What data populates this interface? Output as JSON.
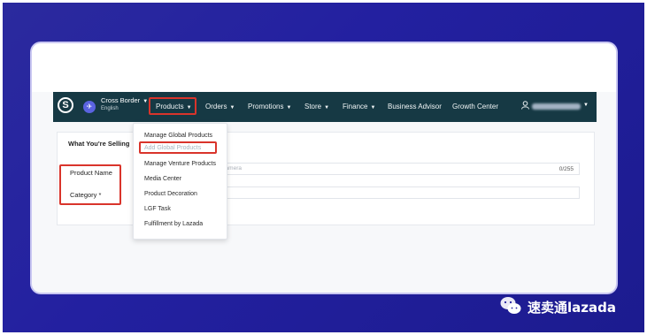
{
  "navbar": {
    "cross_border": "Cross Border",
    "language": "English",
    "items": [
      "Products",
      "Orders",
      "Promotions",
      "Store",
      "Finance",
      "Business Advisor",
      "Growth Center"
    ]
  },
  "products_menu": {
    "items": [
      "Manage Global Products",
      "Add Global Products",
      "Manage Venture Products",
      "Media Center",
      "Product Decoration",
      "LGF Task",
      "Fulfillment by Lazada"
    ],
    "highlighted": "Add Global Products"
  },
  "form": {
    "section_title": "What You're Selling",
    "product_name_label": "Product Name",
    "category_label": "Category *",
    "product_name_placeholder": "al Camera",
    "char_counter": "0/255"
  },
  "watermark": {
    "text": "速卖通lazada"
  },
  "colors": {
    "navbar": "#163944",
    "highlight_border": "#d9342b",
    "frame": "#2320a0"
  }
}
